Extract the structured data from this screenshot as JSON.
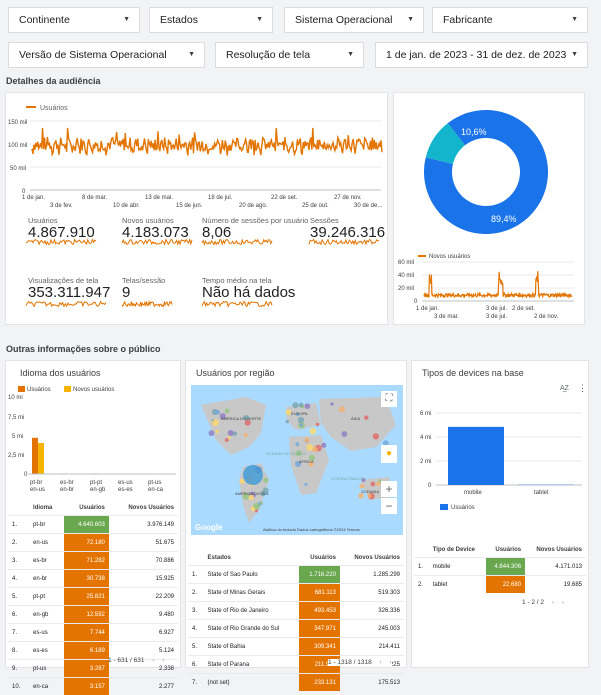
{
  "filters": {
    "continent": "Continente",
    "states": "Estados",
    "os": "Sistema Operacional",
    "manufacturer": "Fabricante",
    "os_version": "Versão de Sistema Operacional",
    "resolution": "Resolução de tela",
    "date_range": "1 de jan. de 2023 - 31 de dez. de 2023"
  },
  "sections": {
    "audience": "Detalhes da audiência",
    "other": "Outras informações sobre o público"
  },
  "kpis": [
    {
      "label": "Usuários",
      "value": "4.867.910"
    },
    {
      "label": "Novos usuários",
      "value": "4.183.073"
    },
    {
      "label": "Número de sessões por usuário",
      "value": "8,06"
    },
    {
      "label": "Sessões",
      "value": "39.246.316"
    },
    {
      "label": "Visualizações de tela",
      "value": "353.311.947"
    },
    {
      "label": "Telas/sessão",
      "value": "9"
    },
    {
      "label": "Tempo médio na tela",
      "value": "Não há dados"
    }
  ],
  "colors": {
    "orange": "#e37400",
    "blue": "#1a73e8",
    "teal": "#12b5cb",
    "green": "#6aa84f",
    "yellow": "#f4b400"
  },
  "cards": {
    "language": "Idioma dos usuários",
    "region": "Usuários por região",
    "devices": "Tipos de devices na base"
  },
  "lang_table": {
    "headers": [
      "Idioma",
      "Usuários",
      "Novos Usuários"
    ],
    "rows": [
      [
        "1.",
        "pt-br",
        "4.640.603",
        "3.976.149"
      ],
      [
        "2.",
        "en-us",
        "72.180",
        "51.675"
      ],
      [
        "3.",
        "es-br",
        "71.282",
        "70.886"
      ],
      [
        "4.",
        "en-br",
        "30.738",
        "15.925"
      ],
      [
        "5.",
        "pt-pt",
        "25.821",
        "22.209"
      ],
      [
        "6.",
        "en-gb",
        "12.592",
        "9.480"
      ],
      [
        "7.",
        "es-us",
        "7.744",
        "6.927"
      ],
      [
        "8.",
        "es-es",
        "6.189",
        "5.124"
      ],
      [
        "9.",
        "pt-us",
        "3.287",
        "2.338"
      ],
      [
        "10.",
        "en-ca",
        "3.157",
        "2.277"
      ]
    ],
    "pager": "1 - 631 / 631"
  },
  "region_table": {
    "headers": [
      "Estados",
      "Usuários",
      "Novos Usuários"
    ],
    "rows": [
      [
        "1.",
        "State of Sao Paulo",
        "1.716.220",
        "1.285.299"
      ],
      [
        "2.",
        "State of Minas Gerais",
        "681.113",
        "519.303"
      ],
      [
        "3.",
        "State of Rio de Janeiro",
        "493.453",
        "326.336"
      ],
      [
        "4.",
        "State of Rio Grande do Sul",
        "347.971",
        "245.003"
      ],
      [
        "5.",
        "State of Bahia",
        "309.341",
        "214.411"
      ],
      [
        "6.",
        "State of Parana",
        "211.986",
        "137.225"
      ],
      [
        "7.",
        "(not set)",
        "233.131",
        "175.513"
      ]
    ],
    "pager": "1 - 1318 / 1318"
  },
  "device_table": {
    "headers": [
      "Tipo de Device",
      "Usuários",
      "Novos Usuários"
    ],
    "rows": [
      [
        "1.",
        "mobile",
        "4.844.306",
        "4.171.013"
      ],
      [
        "2.",
        "tablet",
        "22.680",
        "19.685"
      ]
    ],
    "pager": "1 - 2 / 2"
  },
  "map": {
    "attribution": "Atalhos do teclado   Dados cartográficos ©2024   Termos",
    "labels": [
      "AMÉRICA DO NORTE",
      "EUROPA",
      "ÁFRICA",
      "AMÉRICA DO SUL",
      "OCEANO ATLÂNTICO",
      "OCEANO ÍNDICO",
      "ÁSIA",
      "OCEANIA"
    ],
    "google": "Google"
  },
  "chart_data": [
    {
      "type": "line",
      "series": [
        {
          "name": "Usuários"
        }
      ],
      "x_ticks_top": [
        "1 de jan.",
        "8 de mar.",
        "13 de mai.",
        "18 de jul.",
        "22 de set.",
        "27 de nov."
      ],
      "x_ticks_bottom": [
        "3 de fev.",
        "10 de abr.",
        "15 de jun.",
        "20 de ago.",
        "25 de out.",
        "30 de de..."
      ],
      "y_ticks": [
        "0",
        "50 mil",
        "100 mil",
        "150 mil"
      ],
      "ylim": [
        0,
        150000
      ],
      "approx_mean": 100000,
      "approx_range": [
        80000,
        130000
      ]
    },
    {
      "type": "pie",
      "slices": [
        {
          "label": "mobile",
          "value": 89.4,
          "text": "89,4%"
        },
        {
          "label": "tablet",
          "value": 10.6,
          "text": "10,6%"
        }
      ]
    },
    {
      "type": "line",
      "series": [
        {
          "name": "Novos usuários"
        }
      ],
      "x_ticks_top": [
        "1 de jan.",
        "3 de jul.",
        "2 de set."
      ],
      "x_ticks_bottom": [
        "3 de mar.",
        "3 de jul.",
        "2 de nov."
      ],
      "y_ticks": [
        "0",
        "20 mil",
        "40 mil",
        "60 mil"
      ],
      "ylim": [
        0,
        60000
      ]
    },
    {
      "type": "bar",
      "categories": [
        [
          "pt-br",
          "en-us"
        ],
        [
          "es-br",
          "en-br"
        ],
        [
          "pt-pt",
          "en-gb"
        ],
        [
          "es-us",
          "es-es"
        ],
        [
          "pt-us",
          "en-ca"
        ]
      ],
      "series": [
        {
          "name": "Usuários",
          "values": [
            4640603,
            72180,
            71282,
            30738,
            25821
          ]
        },
        {
          "name": "Novos usuários",
          "values": [
            3976149,
            51675,
            70886,
            15925,
            22209
          ]
        }
      ],
      "y_ticks": [
        "0",
        "2,5 mi",
        "5 mi",
        "7,5 mi",
        "10 mi"
      ],
      "ylim": [
        0,
        10000000
      ]
    },
    {
      "type": "bar",
      "categories": [
        "mobile",
        "tablet"
      ],
      "series": [
        {
          "name": "Usuários",
          "values": [
            4844306,
            22680
          ]
        }
      ],
      "y_ticks": [
        "0",
        "2 mi",
        "4 mi",
        "6 mi"
      ],
      "ylim": [
        0,
        6000000
      ]
    }
  ]
}
